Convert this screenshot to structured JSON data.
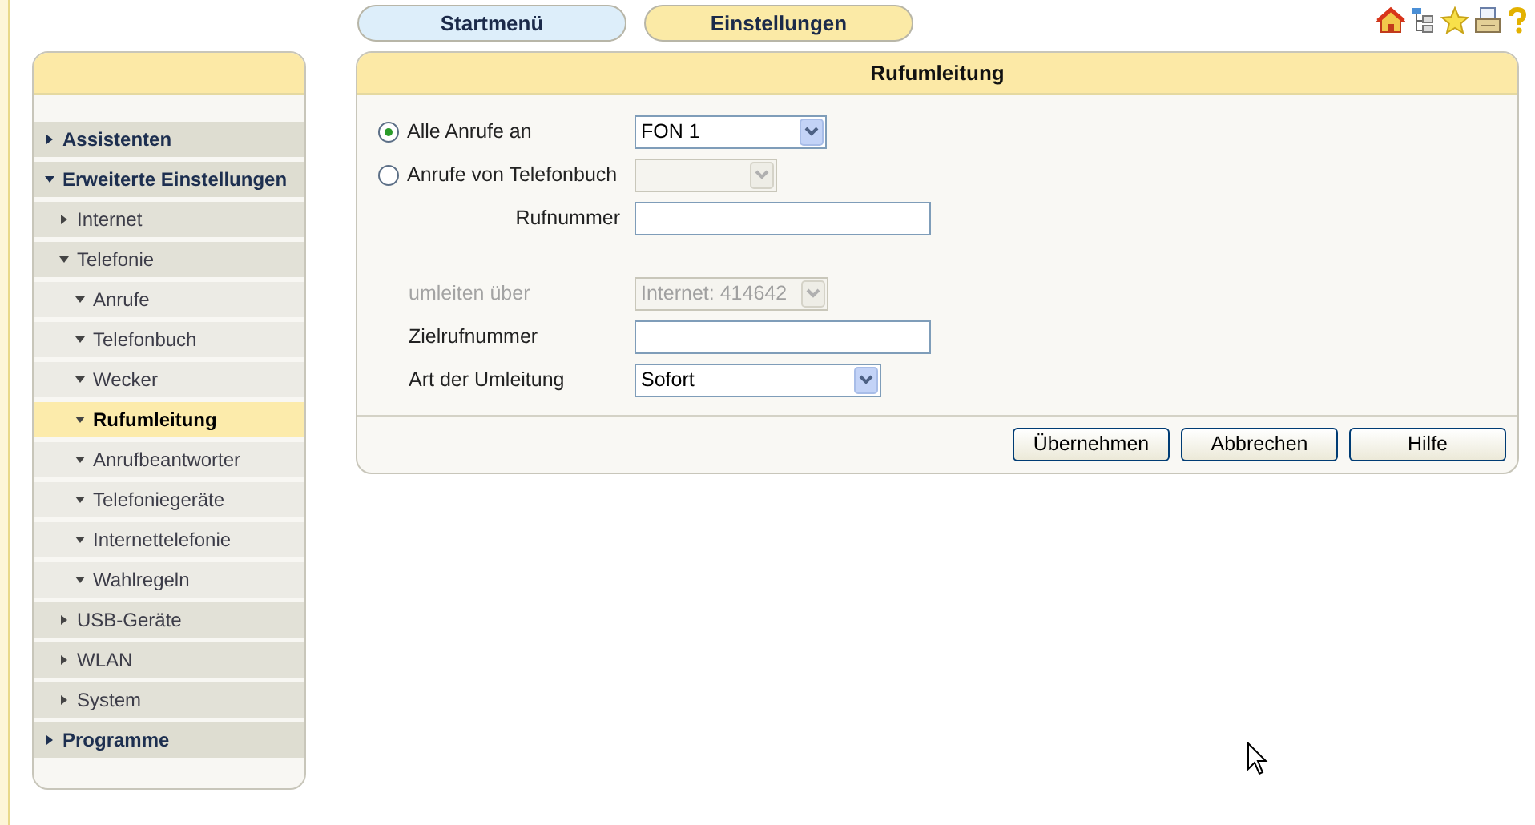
{
  "tabs": [
    {
      "label": "Startmenü",
      "selected": false
    },
    {
      "label": "Einstellungen",
      "selected": true
    }
  ],
  "sidebar": {
    "items": [
      {
        "label": "Assistenten",
        "expanded": false,
        "selected": false
      },
      {
        "label": "Erweiterte Einstellungen",
        "expanded": true,
        "selected": false,
        "children": [
          {
            "label": "Internet",
            "expanded": false,
            "selected": false
          },
          {
            "label": "Telefonie",
            "expanded": true,
            "selected": false,
            "children": [
              {
                "label": "Anrufe",
                "expanded": true,
                "selected": false
              },
              {
                "label": "Telefonbuch",
                "expanded": true,
                "selected": false
              },
              {
                "label": "Wecker",
                "expanded": true,
                "selected": false
              },
              {
                "label": "Rufumleitung",
                "expanded": true,
                "selected": true
              },
              {
                "label": "Anrufbeantworter",
                "expanded": true,
                "selected": false
              },
              {
                "label": "Telefoniegeräte",
                "expanded": true,
                "selected": false
              },
              {
                "label": "Internettelefonie",
                "expanded": true,
                "selected": false
              },
              {
                "label": "Wahlregeln",
                "expanded": true,
                "selected": false
              }
            ]
          },
          {
            "label": "USB-Geräte",
            "expanded": false,
            "selected": false
          },
          {
            "label": "WLAN",
            "expanded": false,
            "selected": false
          },
          {
            "label": "System",
            "expanded": false,
            "selected": false
          }
        ]
      },
      {
        "label": "Programme",
        "expanded": false,
        "selected": false
      }
    ]
  },
  "panel": {
    "title": "Rufumleitung",
    "rows": [
      {
        "kind": "radio",
        "label": "Alle Anrufe an",
        "selected": true,
        "control": {
          "kind": "select",
          "value": "FON 1",
          "disabled": false
        }
      },
      {
        "kind": "radio",
        "label": "Anrufe von Telefonbuch",
        "selected": false,
        "control": {
          "kind": "select",
          "disabled": true
        }
      },
      {
        "kind": "sub",
        "label": "Rufnummer",
        "control": {
          "kind": "text"
        }
      },
      {
        "kind": "gap"
      },
      {
        "kind": "plain",
        "label": "umleiten über",
        "disabled": true,
        "control": {
          "kind": "select",
          "value": "Internet: 414642",
          "disabled": true
        }
      },
      {
        "kind": "plain",
        "label": "Zielrufnummer",
        "disabled": false,
        "control": {
          "kind": "text"
        }
      },
      {
        "kind": "plain",
        "label": "Art der Umleitung",
        "disabled": false,
        "control": {
          "kind": "select",
          "value": "Sofort",
          "disabled": false
        }
      }
    ],
    "buttons": [
      "Übernehmen",
      "Abbrechen",
      "Hilfe"
    ]
  }
}
